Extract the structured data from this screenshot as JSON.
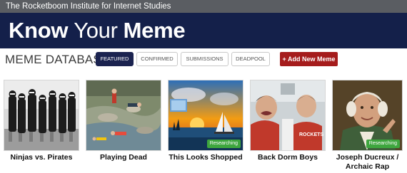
{
  "site": {
    "header_text": "The Rocketboom Institute for Internet Studies",
    "logo": {
      "word1": "Know",
      "word2": "Your",
      "word3": "Meme"
    }
  },
  "database": {
    "title": "MEME DATABASE",
    "tabs": [
      {
        "label": "FEATURED",
        "active": true
      },
      {
        "label": "CONFIRMED",
        "active": false
      },
      {
        "label": "SUBMISSIONS",
        "active": false
      },
      {
        "label": "DEADPOOL",
        "active": false
      }
    ],
    "add_button": "+ Add New Meme"
  },
  "memes": [
    {
      "title": "Ninjas vs. Pirates",
      "badge": ""
    },
    {
      "title": "Playing Dead",
      "badge": ""
    },
    {
      "title": "This Looks Shopped",
      "badge": "Researching"
    },
    {
      "title": "Back Dorm Boys",
      "badge": ""
    },
    {
      "title": "Joseph Ducreux / Archaic Rap",
      "badge": "Researching"
    }
  ],
  "colors": {
    "topbar": "#5a5d62",
    "banner": "#14204a",
    "tab_active": "#1b2350",
    "add_button": "#a51c1c",
    "badge": "#3ea63e"
  }
}
